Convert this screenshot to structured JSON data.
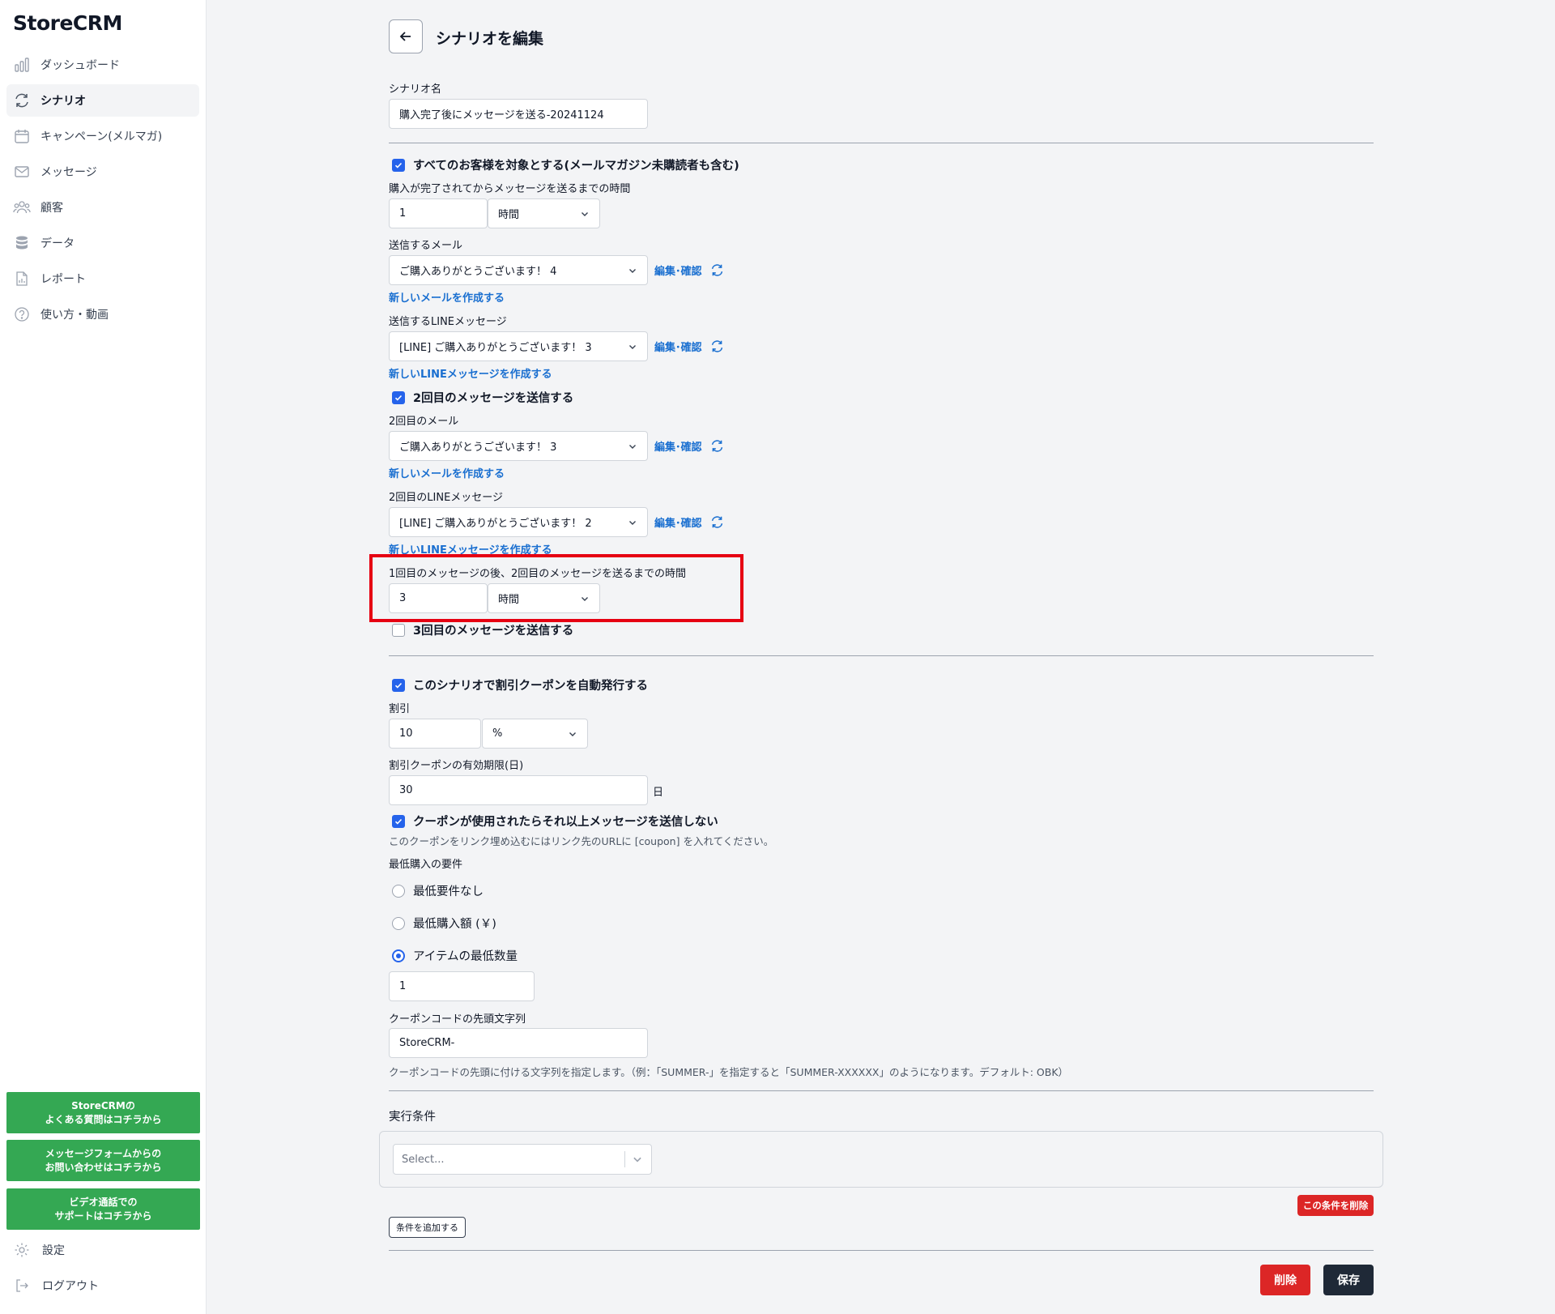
{
  "app": {
    "logo": "StoreCRM"
  },
  "sidebar": {
    "items": [
      {
        "label": "ダッシュボード",
        "icon": "bar-chart-icon"
      },
      {
        "label": "シナリオ",
        "icon": "refresh-icon"
      },
      {
        "label": "キャンペーン(メルマガ)",
        "icon": "calendar-icon"
      },
      {
        "label": "メッセージ",
        "icon": "mail-icon"
      },
      {
        "label": "顧客",
        "icon": "users-icon"
      },
      {
        "label": "データ",
        "icon": "database-icon"
      },
      {
        "label": "レポート",
        "icon": "document-chart-icon"
      },
      {
        "label": "使い方・動画",
        "icon": "question-icon"
      }
    ],
    "help_buttons": [
      "StoreCRMの\nよくある質問はコチラから",
      "メッセージフォームからの\nお問い合わせはコチラから",
      "ビデオ通話での\nサポートはコチラから"
    ],
    "settings_label": "設定",
    "logout_label": "ログアウト",
    "accent_color": "#34a853"
  },
  "page": {
    "title": "シナリオを編集",
    "scenario_name_label": "シナリオ名",
    "scenario_name_value": "購入完了後にメッセージを送る-20241124",
    "all_customers_label": "すべてのお客様を対象とする(メールマガジン未購読者も含む)",
    "first_delay_label": "購入が完了されてからメッセージを送るまでの時間",
    "first_delay_value": "1",
    "first_delay_unit": "時間",
    "mail_label": "送信するメール",
    "mail_value": "ご購入ありがとうございます！ 4",
    "edit_confirm": "編集･確認",
    "new_mail_link": "新しいメールを作成する",
    "line_label": "送信するLINEメッセージ",
    "line_value": "[LINE] ご購入ありがとうございます！ 3",
    "new_line_link": "新しいLINEメッセージを作成する",
    "second_send_label": "2回目のメッセージを送信する",
    "second_mail_label": "2回目のメール",
    "second_mail_value": "ご購入ありがとうございます！ 3",
    "second_line_label": "2回目のLINEメッセージ",
    "second_line_value": "[LINE] ご購入ありがとうございます！ 2",
    "second_delay_label": "1回目のメッセージの後、2回目のメッセージを送るまでの時間",
    "second_delay_value": "3",
    "second_delay_unit": "時間",
    "third_send_label": "3回目のメッセージを送信する",
    "coupon_auto_label": "このシナリオで割引クーポンを自動発行する",
    "discount_label": "割引",
    "discount_value": "10",
    "discount_unit": "%",
    "coupon_expiry_label": "割引クーポンの有効期限(日)",
    "coupon_expiry_value": "30",
    "day_unit": "日",
    "stop_on_use_label": "クーポンが使用されたらそれ以上メッセージを送信しない",
    "coupon_note": "このクーポンをリンク埋め込むにはリンク先のURLに [coupon] を入れてください。",
    "min_purchase_label": "最低購入の要件",
    "radio_none": "最低要件なし",
    "radio_amount": "最低購入額 (￥)",
    "radio_qty": "アイテムの最低数量",
    "min_qty_value": "1",
    "prefix_label": "クーポンコードの先頭文字列",
    "prefix_value": "StoreCRM-",
    "prefix_note": "クーポンコードの先頭に付ける文字列を指定します。（例：「SUMMER-」を指定すると「SUMMER-XXXXXX」のようになります。デフォルト: OBK）",
    "conditions_label": "実行条件",
    "select_placeholder": "Select...",
    "delete_condition": "この条件を削除",
    "add_condition": "条件を追加する",
    "delete_button": "削除",
    "save_button": "保存",
    "highlight_color": "#e60012"
  }
}
